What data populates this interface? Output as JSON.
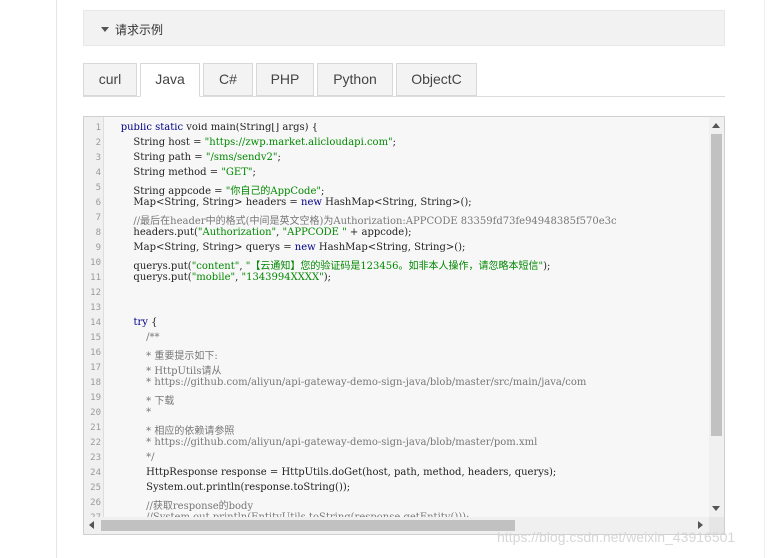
{
  "section": {
    "title": "请求示例"
  },
  "tabs": [
    {
      "label": "curl",
      "active": false
    },
    {
      "label": "Java",
      "active": true
    },
    {
      "label": "C#",
      "active": false
    },
    {
      "label": "PHP",
      "active": false
    },
    {
      "label": "Python",
      "active": false
    },
    {
      "label": "ObjectC",
      "active": false
    }
  ],
  "code_lines": [
    [
      [
        "",
        "    "
      ],
      [
        "kw",
        "public static "
      ],
      [
        "",
        "void main(String[] args) {"
      ]
    ],
    [
      [
        "",
        "        String host = "
      ],
      [
        "str",
        "\"https://zwp.market.alicloudapi.com\""
      ],
      [
        "",
        ";"
      ]
    ],
    [
      [
        "",
        "        String path = "
      ],
      [
        "str",
        "\"/sms/sendv2\""
      ],
      [
        "",
        ";"
      ]
    ],
    [
      [
        "",
        "        String method = "
      ],
      [
        "str",
        "\"GET\""
      ],
      [
        "",
        ";"
      ]
    ],
    [
      [
        "",
        "        String appcode = "
      ],
      [
        "str",
        "\"你自己的AppCode\""
      ],
      [
        "",
        ";"
      ]
    ],
    [
      [
        "",
        "        Map<String, String> headers = "
      ],
      [
        "kw",
        "new "
      ],
      [
        "",
        "HashMap<String, String>();"
      ]
    ],
    [
      [
        "com",
        "        //最后在header中的格式(中间是英文空格)为Authorization:APPCODE 83359fd73fe94948385f570e3c"
      ]
    ],
    [
      [
        "",
        "        headers.put("
      ],
      [
        "str",
        "\"Authorization\""
      ],
      [
        "",
        ", "
      ],
      [
        "str",
        "\"APPCODE \""
      ],
      [
        "",
        " + appcode);"
      ]
    ],
    [
      [
        "",
        "        Map<String, String> querys = "
      ],
      [
        "kw",
        "new "
      ],
      [
        "",
        "HashMap<String, String>();"
      ]
    ],
    [
      [
        "",
        "        querys.put("
      ],
      [
        "str",
        "\"content\""
      ],
      [
        "",
        ", "
      ],
      [
        "str",
        "\"【云通知】您的验证码是123456。如非本人操作，请忽略本短信\""
      ],
      [
        "",
        ");"
      ]
    ],
    [
      [
        "",
        "        querys.put("
      ],
      [
        "str",
        "\"mobile\""
      ],
      [
        "",
        ", "
      ],
      [
        "str",
        "\"1343994XXXX\""
      ],
      [
        "",
        ");"
      ]
    ],
    [
      [
        "",
        ""
      ]
    ],
    [
      [
        "",
        ""
      ]
    ],
    [
      [
        "",
        "        "
      ],
      [
        "kw",
        "try "
      ],
      [
        "",
        "{"
      ]
    ],
    [
      [
        "com",
        "            /**"
      ]
    ],
    [
      [
        "com",
        "            * 重要提示如下:"
      ]
    ],
    [
      [
        "com",
        "            * HttpUtils请从"
      ]
    ],
    [
      [
        "com",
        "            * https://github.com/aliyun/api-gateway-demo-sign-java/blob/master/src/main/java/com"
      ]
    ],
    [
      [
        "com",
        "            * 下载"
      ]
    ],
    [
      [
        "com",
        "            *"
      ]
    ],
    [
      [
        "com",
        "            * 相应的依赖请参照"
      ]
    ],
    [
      [
        "com",
        "            * https://github.com/aliyun/api-gateway-demo-sign-java/blob/master/pom.xml"
      ]
    ],
    [
      [
        "com",
        "            */"
      ]
    ],
    [
      [
        "",
        "            HttpResponse response = HttpUtils.doGet(host, path, method, headers, querys);"
      ]
    ],
    [
      [
        "",
        "            System.out.println(response.toString());"
      ]
    ],
    [
      [
        "com",
        "            //获取response的body"
      ]
    ],
    [
      [
        "com",
        "            //System.out.println(EntityUtils.toString(response.getEntity()));"
      ]
    ]
  ],
  "watermark": "https://blog.csdn.net/weixin_43916501"
}
